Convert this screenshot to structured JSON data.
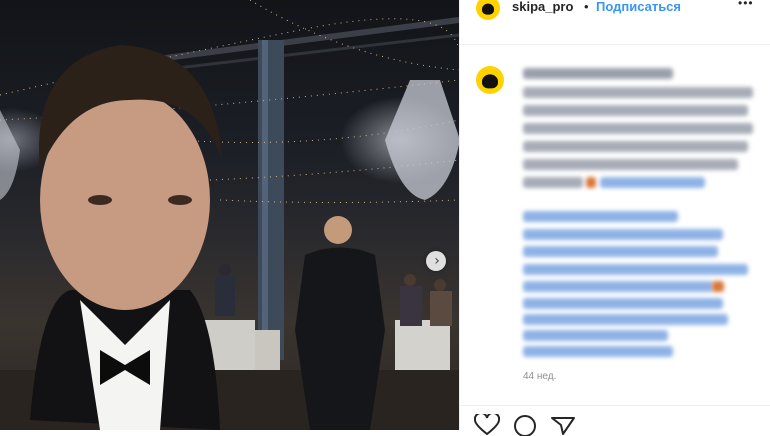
{
  "post": {
    "username": "skipa_pro",
    "separator": "•",
    "follow_label": "Подписаться",
    "more_label": "•••",
    "timestamp": "44 нед."
  },
  "icons": {
    "next": "chevron-right-icon",
    "like": "heart-icon",
    "comment": "comment-icon",
    "share": "share-icon",
    "more": "more-options-icon"
  },
  "colors": {
    "follow": "#3897f0",
    "avatar_bg": "#ffd200",
    "caption_blur_dark": "#9aa0ab",
    "caption_blur_blue": "#8fb2e6"
  }
}
